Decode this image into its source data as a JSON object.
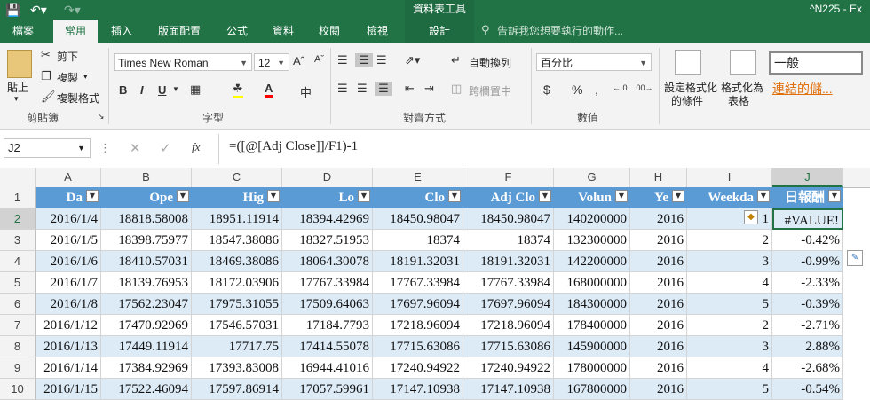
{
  "title_bar": {
    "context_tool": "資料表工具",
    "file_title": "^N225 - Ex"
  },
  "tabs": [
    {
      "label": "檔案",
      "active": false
    },
    {
      "label": "常用",
      "active": true
    },
    {
      "label": "插入",
      "active": false
    },
    {
      "label": "版面配置",
      "active": false
    },
    {
      "label": "公式",
      "active": false
    },
    {
      "label": "資料",
      "active": false
    },
    {
      "label": "校閱",
      "active": false
    },
    {
      "label": "檢視",
      "active": false
    },
    {
      "label": "設計",
      "active": false
    }
  ],
  "tell_me": "告訴我您想要執行的動作...",
  "ribbon": {
    "clipboard": {
      "paste": "貼上",
      "cut": "剪下",
      "copy": "複製",
      "format_painter": "複製格式",
      "group": "剪貼簿"
    },
    "font": {
      "name": "Times New Roman",
      "size": "12",
      "bold": "B",
      "italic": "I",
      "underline": "U",
      "phonetic": "中",
      "group": "字型"
    },
    "alignment": {
      "wrap": "自動換列",
      "merge": "跨欄置中",
      "group": "對齊方式"
    },
    "number": {
      "format": "百分比",
      "currency": "$",
      "percent": "%",
      "comma": ",",
      "group": "數值"
    },
    "styles": {
      "conditional": "設定格式化",
      "conditional2": "的條件",
      "as_table": "格式化為",
      "as_table2": "表格",
      "normal": "一般",
      "hyperlink": "連結的儲..."
    }
  },
  "formula_bar": {
    "name_box": "J2",
    "fx": "fx",
    "formula": "=([@[Adj Close]]/F1)-1"
  },
  "grid": {
    "columns": [
      "A",
      "B",
      "C",
      "D",
      "E",
      "F",
      "G",
      "H",
      "I",
      "J"
    ],
    "selected_column": "J",
    "headers": [
      "Da",
      "Ope",
      "Hig",
      "Lo",
      "Clo",
      "Adj Clo",
      "Volun",
      "Ye",
      "Weekda",
      "日報酬"
    ],
    "rows": [
      {
        "n": "2",
        "cells": [
          "2016/1/4",
          "18818.58008",
          "18951.11914",
          "18394.42969",
          "18450.98047",
          "18450.98047",
          "140200000",
          "2016",
          "1",
          "#VALUE!"
        ]
      },
      {
        "n": "3",
        "cells": [
          "2016/1/5",
          "18398.75977",
          "18547.38086",
          "18327.51953",
          "18374",
          "18374",
          "132300000",
          "2016",
          "2",
          "-0.42%"
        ]
      },
      {
        "n": "4",
        "cells": [
          "2016/1/6",
          "18410.57031",
          "18469.38086",
          "18064.30078",
          "18191.32031",
          "18191.32031",
          "142200000",
          "2016",
          "3",
          "-0.99%"
        ]
      },
      {
        "n": "5",
        "cells": [
          "2016/1/7",
          "18139.76953",
          "18172.03906",
          "17767.33984",
          "17767.33984",
          "17767.33984",
          "168000000",
          "2016",
          "4",
          "-2.33%"
        ]
      },
      {
        "n": "6",
        "cells": [
          "2016/1/8",
          "17562.23047",
          "17975.31055",
          "17509.64063",
          "17697.96094",
          "17697.96094",
          "184300000",
          "2016",
          "5",
          "-0.39%"
        ]
      },
      {
        "n": "7",
        "cells": [
          "2016/1/12",
          "17470.92969",
          "17546.57031",
          "17184.7793",
          "17218.96094",
          "17218.96094",
          "178400000",
          "2016",
          "2",
          "-2.71%"
        ]
      },
      {
        "n": "8",
        "cells": [
          "2016/1/13",
          "17449.11914",
          "17717.75",
          "17414.55078",
          "17715.63086",
          "17715.63086",
          "145900000",
          "2016",
          "3",
          "2.88%"
        ]
      },
      {
        "n": "9",
        "cells": [
          "2016/1/14",
          "17384.92969",
          "17393.83008",
          "16944.41016",
          "17240.94922",
          "17240.94922",
          "178000000",
          "2016",
          "4",
          "-2.68%"
        ]
      },
      {
        "n": "10",
        "cells": [
          "2016/1/15",
          "17522.46094",
          "17597.86914",
          "17057.59961",
          "17147.10938",
          "17147.10938",
          "167800000",
          "2016",
          "5",
          "-0.54%"
        ]
      }
    ]
  },
  "colors": {
    "excel_green": "#217346",
    "table_header": "#5b9bd5",
    "band": "#ddebf7"
  }
}
